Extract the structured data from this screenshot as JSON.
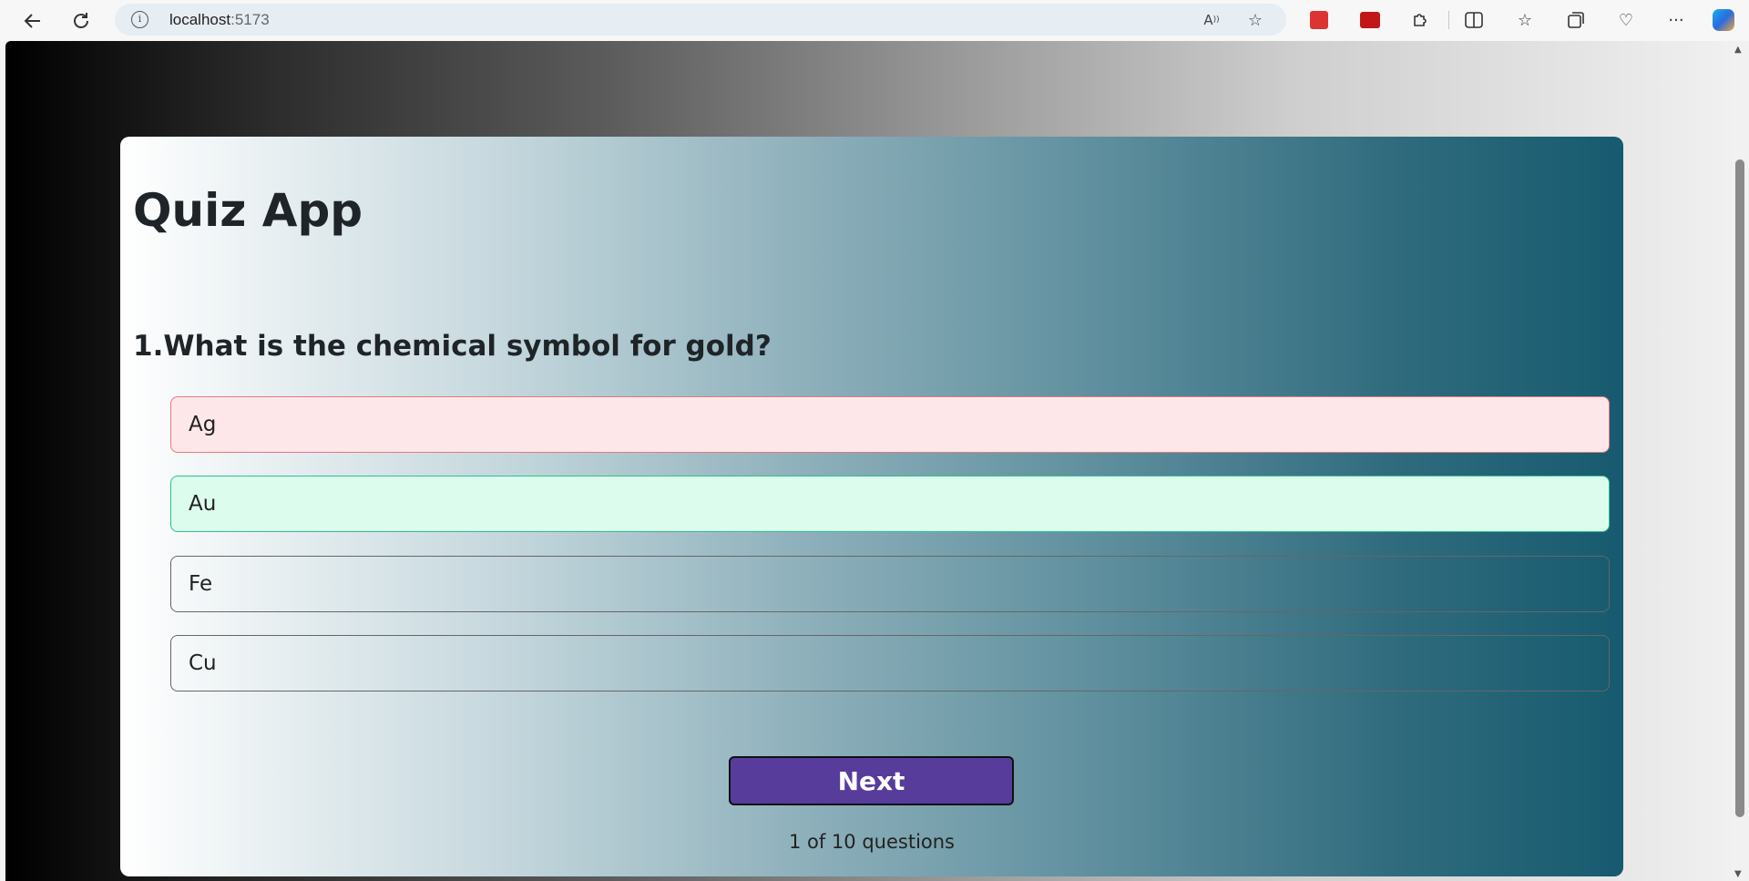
{
  "browser": {
    "url_host": "localhost",
    "url_port": ":5173",
    "icons": [
      "back-icon",
      "refresh-icon",
      "info-icon",
      "read-aloud-icon",
      "favorite-star-icon",
      "extension-red-icon",
      "extension-red-2-icon",
      "extensions-puzzle-icon",
      "split-screen-icon",
      "favorites-icon",
      "collections-icon",
      "browser-essentials-icon",
      "more-icon",
      "copilot-icon"
    ]
  },
  "quiz": {
    "title": "Quiz App",
    "question": "1.What is the chemical symbol for gold?",
    "options": [
      {
        "label": "Ag",
        "state": "wrong"
      },
      {
        "label": "Au",
        "state": "correct"
      },
      {
        "label": "Fe",
        "state": "none"
      },
      {
        "label": "Cu",
        "state": "none"
      }
    ],
    "next_label": "Next",
    "progress_text": "1 of 10 questions"
  },
  "colors": {
    "wrong_bg": "#fee7e9",
    "correct_bg": "#dcfdee",
    "next_button": "#573c9c"
  }
}
